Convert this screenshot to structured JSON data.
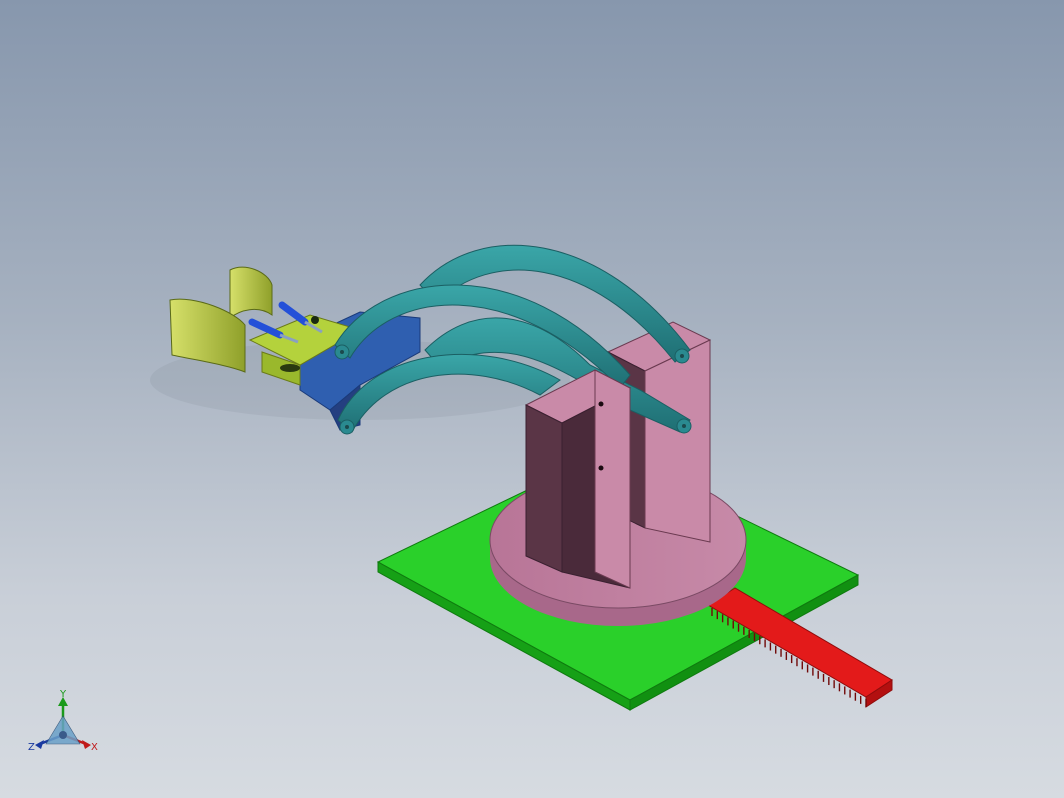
{
  "viewport": {
    "background_top": "#8797ad",
    "background_bottom": "#d6dbe1"
  },
  "colors": {
    "base_plate": "#1fcc1f",
    "turntable": "#c07fa0",
    "upright": "#5a3546",
    "upright_face": "#bb7fa0",
    "links": "#2a8a90",
    "links_edge": "#1d6a6f",
    "gripper_body": "#2f5fb0",
    "gripper_plate": "#b4d23c",
    "jaw": "#bfd24a",
    "actuator": "#2450d8",
    "rack": "#e01818"
  },
  "triad": {
    "y_label": "Y",
    "z_label": "Z",
    "x_label": "X",
    "y_color": "#1a9a1a",
    "z_color": "#1a3aa0",
    "x_color": "#c01a1a"
  }
}
